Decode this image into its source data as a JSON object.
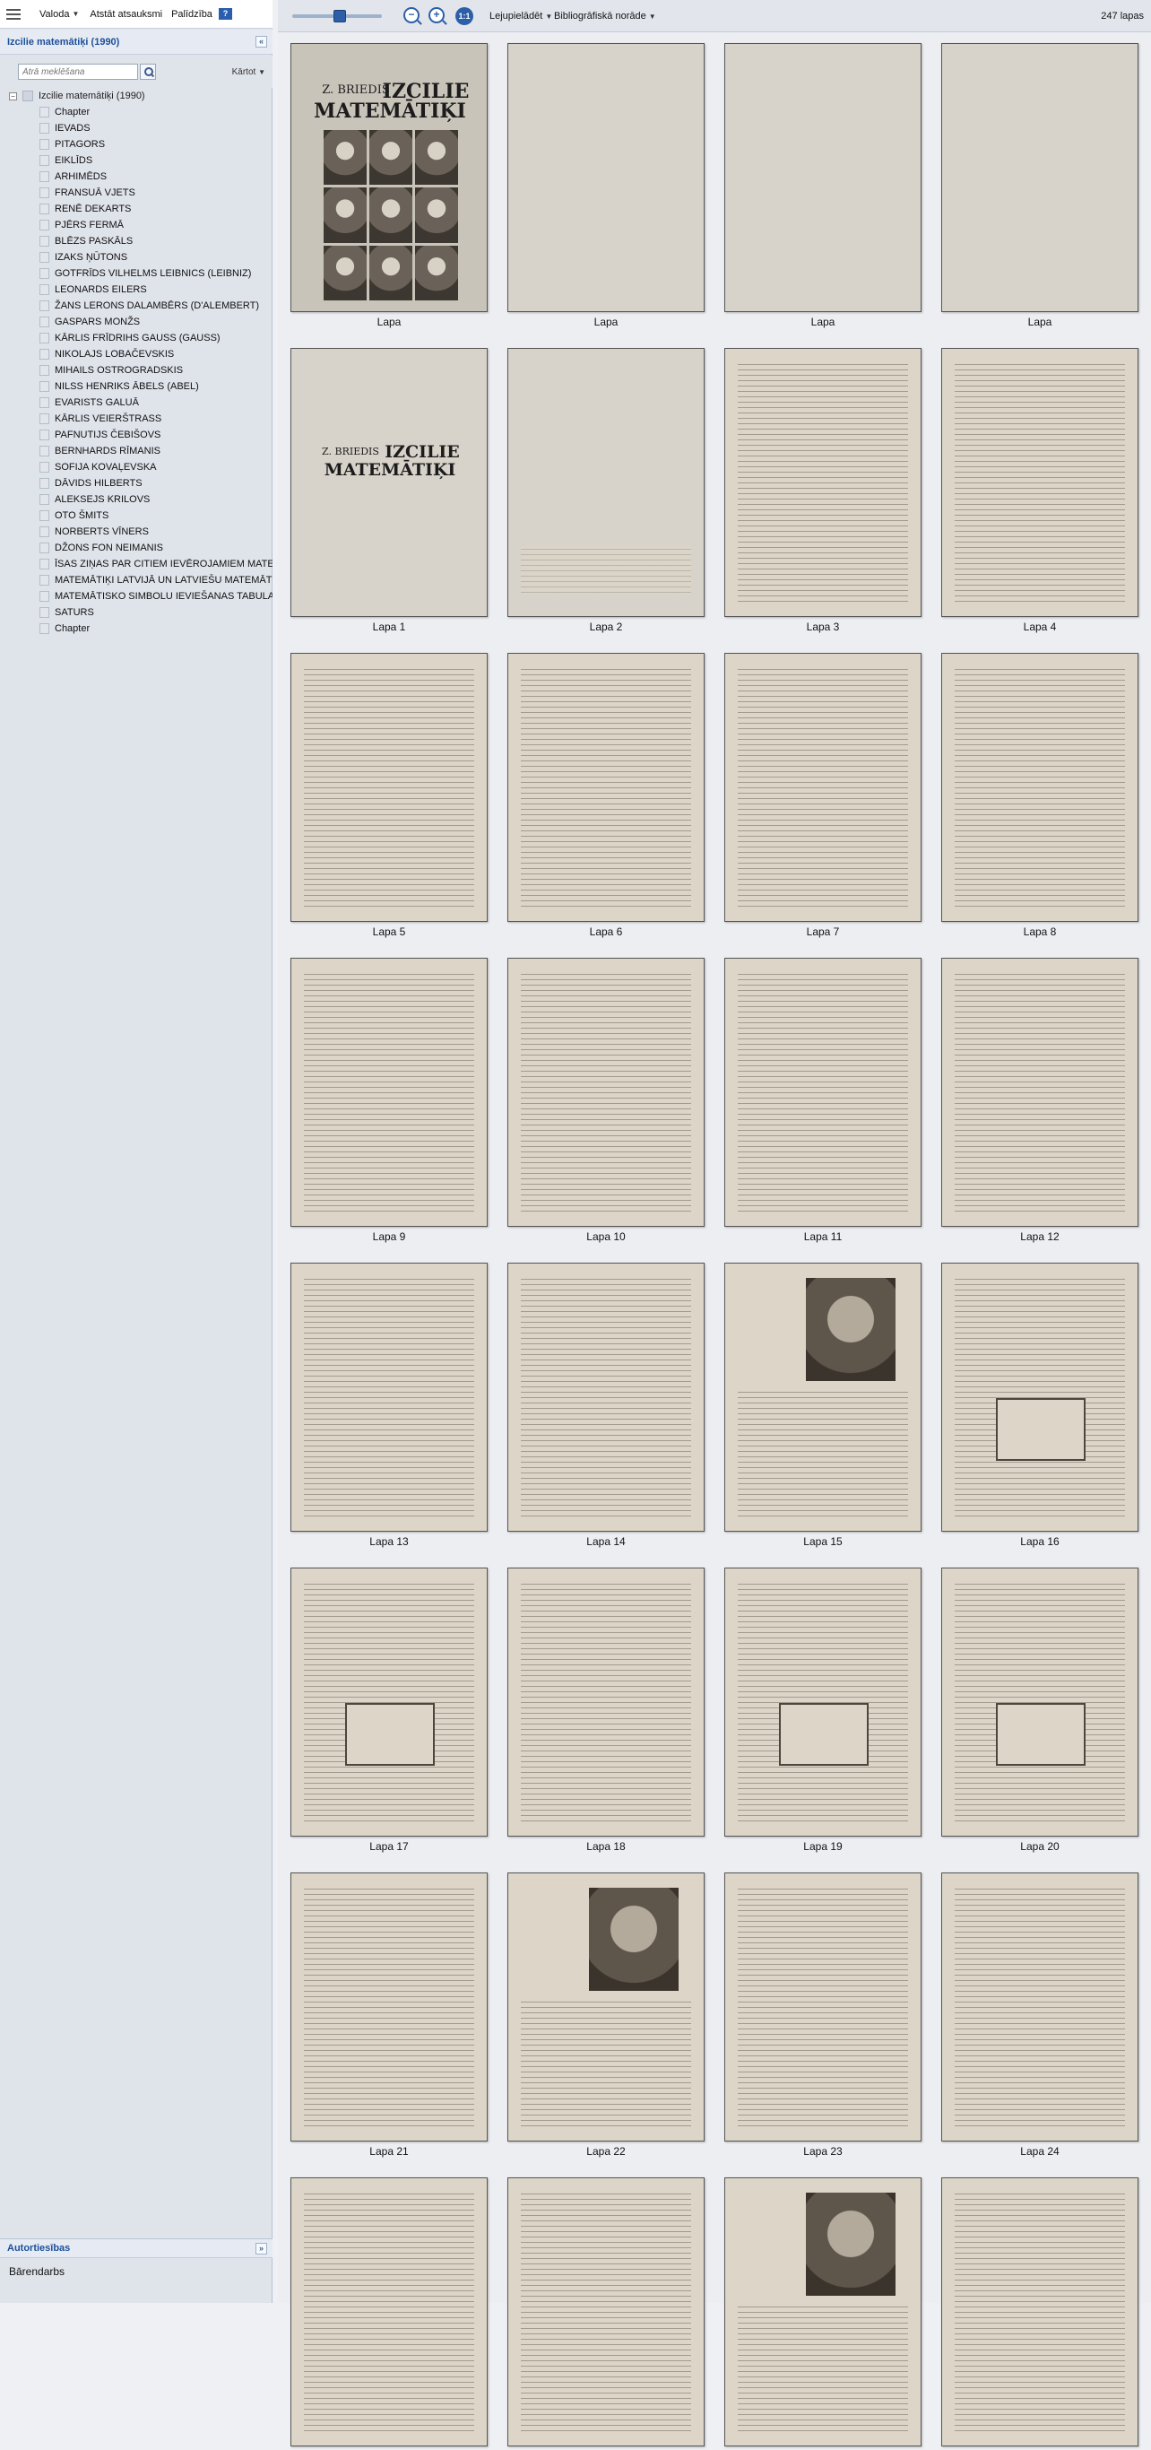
{
  "topbar": {
    "language_label": "Valoda",
    "report_label": "Atstāt atsauksmi",
    "help_label": "Palīdzība",
    "help_icon": "?"
  },
  "document": {
    "title": "Izcilie matemātiķi (1990)",
    "collapse_icon": "«"
  },
  "search": {
    "placeholder": "Ātrā meklēšana",
    "sort_label": "Kārtot"
  },
  "toc": {
    "root_label": "Izcilie matemātiķi (1990)",
    "toggle": "−",
    "items": [
      "Chapter",
      "IEVADS",
      "PITAGORS",
      "EIKLĪDS",
      "ARHIMĒDS",
      "FRANSUĀ VJETS",
      "RENĒ DEKARTS",
      "PJĒRS FERMĀ",
      "BLĒZS PASKĀLS",
      "IZAKS ŅŪTONS",
      "GOTFRĪDS VILHELMS LEIBNICS (LEIBNIZ)",
      "LEONARDS EILERS",
      "ŽANS LERONS DALAMBĒRS (D'ALEMBERT)",
      "GASPARS MONŽS",
      "KĀRLIS FRĪDRIHS GAUSS (GAUSS)",
      "NIKOLAJS LOBAČEVSKIS",
      "MIHAILS OSTROGRADSKIS",
      "NILSS HENRIKS ĀBELS (ABEL)",
      "EVARISTS GALUĀ",
      "KĀRLIS VEIERŠTRASS",
      "PAFNUTIJS ČEBIŠOVS",
      "BERNHARDS RĪMANIS",
      "SOFIJA KOVAĻEVSKA",
      "DĀVIDS HILBERTS",
      "ALEKSEJS KRILOVS",
      "OTO ŠMITS",
      "NORBERTS VĪNERS",
      "DŽONS FON NEIMANIS",
      "ĪSAS ZIŅAS PAR CITIEM IEVĒROJAMIEM MATEMĀTIĶIEM",
      "MATEMĀTIĶI LATVIJĀ UN LATVIEŠU MATEMĀTIĶI",
      "MATEMĀTISKO SIMBOLU IEVIEŠANAS TABULA",
      "SATURS",
      "Chapter"
    ]
  },
  "footer": {
    "section_title": "Autortiesības",
    "license_text": "Bārendarbs"
  },
  "toolbar": {
    "zoom_out_icon": "−",
    "zoom_in_icon": "+",
    "actual_size_label": "1:1",
    "download_label": "Lejupielādēt",
    "citation_label": "Bibliogrāfiskā norāde",
    "page_count": "247 lapas"
  },
  "cover": {
    "author": "Z. BRIEDIS",
    "title_line1": "IZCILIE",
    "title_line2": "MATEMĀTIĶI"
  },
  "thumbnails": [
    {
      "label": "Lapa",
      "kind": "cover"
    },
    {
      "label": "Lapa",
      "kind": "blank"
    },
    {
      "label": "Lapa",
      "kind": "blank"
    },
    {
      "label": "Lapa",
      "kind": "blank"
    },
    {
      "label": "Lapa 1",
      "kind": "title"
    },
    {
      "label": "Lapa 2",
      "kind": "imprint"
    },
    {
      "label": "Lapa 3",
      "kind": "text"
    },
    {
      "label": "Lapa 4",
      "kind": "text"
    },
    {
      "label": "Lapa 5",
      "kind": "text"
    },
    {
      "label": "Lapa 6",
      "kind": "text"
    },
    {
      "label": "Lapa 7",
      "kind": "text"
    },
    {
      "label": "Lapa 8",
      "kind": "text"
    },
    {
      "label": "Lapa 9",
      "kind": "text"
    },
    {
      "label": "Lapa 10",
      "kind": "text"
    },
    {
      "label": "Lapa 11",
      "kind": "text"
    },
    {
      "label": "Lapa 12",
      "kind": "text"
    },
    {
      "label": "Lapa 13",
      "kind": "text"
    },
    {
      "label": "Lapa 14",
      "kind": "text"
    },
    {
      "label": "Lapa 15",
      "kind": "portrait"
    },
    {
      "label": "Lapa 16",
      "kind": "figure"
    },
    {
      "label": "Lapa 17",
      "kind": "figure"
    },
    {
      "label": "Lapa 18",
      "kind": "text"
    },
    {
      "label": "Lapa 19",
      "kind": "figure"
    },
    {
      "label": "Lapa 20",
      "kind": "figure"
    },
    {
      "label": "Lapa 21",
      "kind": "text"
    },
    {
      "label": "Lapa 22",
      "kind": "portrait"
    },
    {
      "label": "Lapa 23",
      "kind": "text"
    },
    {
      "label": "Lapa 24",
      "kind": "text"
    },
    {
      "label": "",
      "kind": "text"
    },
    {
      "label": "",
      "kind": "text"
    },
    {
      "label": "",
      "kind": "portrait"
    },
    {
      "label": "",
      "kind": "text"
    }
  ]
}
